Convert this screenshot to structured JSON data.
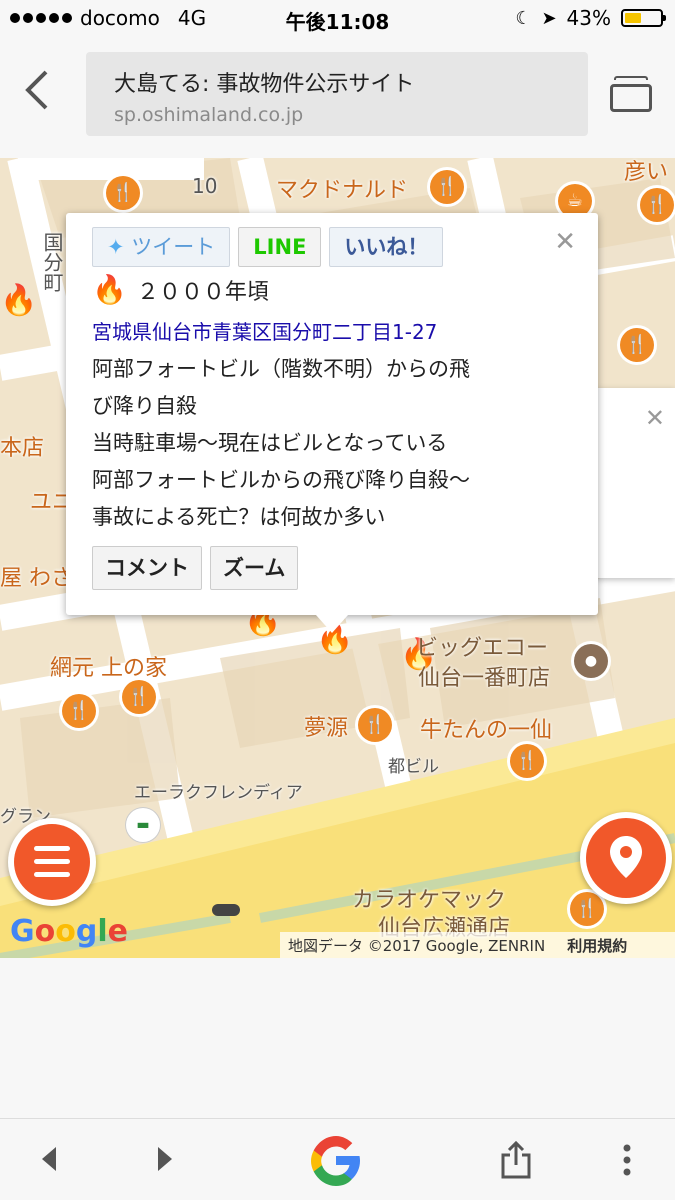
{
  "status": {
    "carrier": "docomo",
    "network": "4G",
    "time": "午後11:08",
    "battery_percent": "43%"
  },
  "browser": {
    "page_title": "大島てる: 事故物件公示サイト",
    "domain": "sp.oshimaland.co.jp"
  },
  "info_window": {
    "tweet_label": "ツイート",
    "line_label": "LINE",
    "like_label": "いいね！",
    "year": "２０００年頃",
    "address": "宮城県仙台市青葉区国分町二丁目1-27",
    "desc_lines": [
      "阿部フォートビル（階数不明）からの飛",
      "び降り自殺",
      "当時駐車場～現在はビルとなっている",
      "阿部フォートビルからの飛び降り自殺～",
      "事故による死亡？は何故か多い"
    ],
    "comment_label": "コメント",
    "zoom_label": "ズーム"
  },
  "map_labels": {
    "mcdonalds": "マクドナルド",
    "bigecho_1": "ビッグエコー",
    "bigecho_2": "仙台一番町店",
    "amimoto": "網元 上の家",
    "mugen": "夢源",
    "gyutan": "牛たんの一仙",
    "to_building": "都ビル",
    "eraku": "エーラクフレンディア",
    "karaoke_1": "カラオケマック",
    "karaoke_2": "仙台広瀬通店",
    "honten": "本店",
    "yuni": "ユニ",
    "yawasa": "屋 わさ",
    "gran": "グラン",
    "kokubun": "国分町",
    "num10": "10",
    "tsui": "彦い"
  },
  "attribution": {
    "copyright": "地図データ ©2017 Google, ZENRIN",
    "terms": "利用規約"
  },
  "google_logo": "Google"
}
